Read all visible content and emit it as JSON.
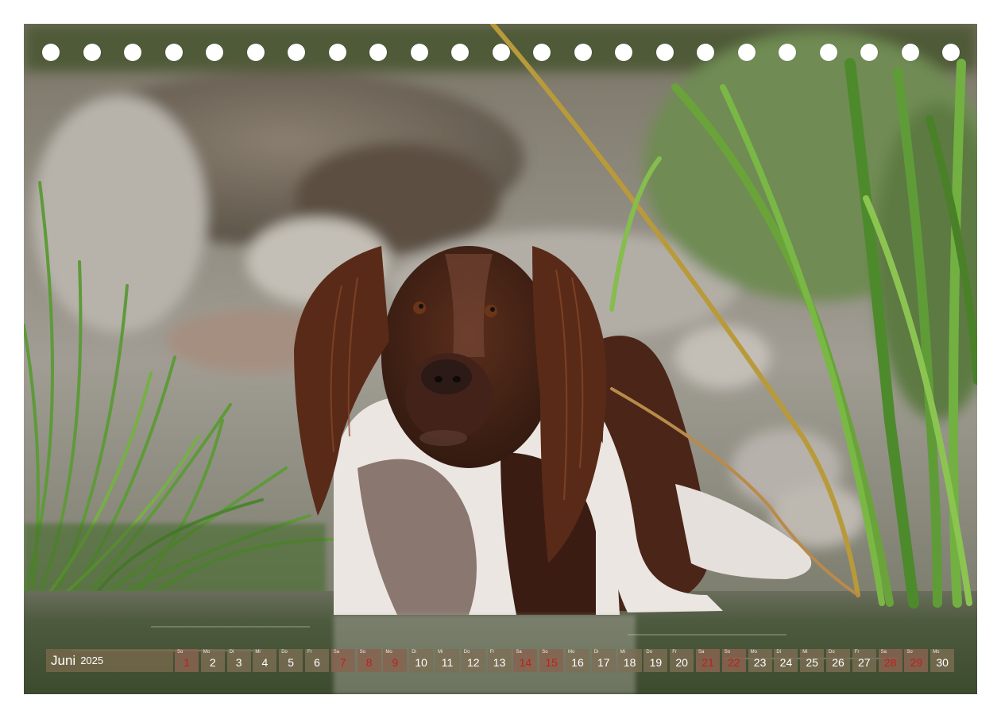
{
  "calendar": {
    "month": "Juni",
    "year": "2025",
    "days": [
      {
        "n": "1",
        "wd": "So",
        "red": true
      },
      {
        "n": "2",
        "wd": "Mo",
        "red": false
      },
      {
        "n": "3",
        "wd": "Di",
        "red": false
      },
      {
        "n": "4",
        "wd": "Mi",
        "red": false
      },
      {
        "n": "5",
        "wd": "Do",
        "red": false
      },
      {
        "n": "6",
        "wd": "Fr",
        "red": false
      },
      {
        "n": "7",
        "wd": "Sa",
        "red": true
      },
      {
        "n": "8",
        "wd": "So",
        "red": true
      },
      {
        "n": "9",
        "wd": "Mo",
        "red": true
      },
      {
        "n": "10",
        "wd": "Di",
        "red": false
      },
      {
        "n": "11",
        "wd": "Mi",
        "red": false
      },
      {
        "n": "12",
        "wd": "Do",
        "red": false
      },
      {
        "n": "13",
        "wd": "Fr",
        "red": false
      },
      {
        "n": "14",
        "wd": "Sa",
        "red": true
      },
      {
        "n": "15",
        "wd": "So",
        "red": true
      },
      {
        "n": "16",
        "wd": "Mo",
        "red": false
      },
      {
        "n": "17",
        "wd": "Di",
        "red": false
      },
      {
        "n": "18",
        "wd": "Mi",
        "red": false
      },
      {
        "n": "19",
        "wd": "Do",
        "red": false
      },
      {
        "n": "20",
        "wd": "Fr",
        "red": false
      },
      {
        "n": "21",
        "wd": "Sa",
        "red": true
      },
      {
        "n": "22",
        "wd": "So",
        "red": true
      },
      {
        "n": "23",
        "wd": "Mo",
        "red": false
      },
      {
        "n": "24",
        "wd": "Di",
        "red": false
      },
      {
        "n": "25",
        "wd": "Mi",
        "red": false
      },
      {
        "n": "26",
        "wd": "Do",
        "red": false
      },
      {
        "n": "27",
        "wd": "Fr",
        "red": false
      },
      {
        "n": "28",
        "wd": "Sa",
        "red": true
      },
      {
        "n": "29",
        "wd": "So",
        "red": true
      },
      {
        "n": "30",
        "wd": "Mo",
        "red": false
      }
    ]
  },
  "binding_holes": 23,
  "colors": {
    "background_blur": "#8a8478",
    "water": "#4f5a42",
    "dog_brown": "#4a2518",
    "dog_white": "#ece6e2",
    "grass": "#5f9a3a",
    "holiday_red": "#c41d1d"
  }
}
